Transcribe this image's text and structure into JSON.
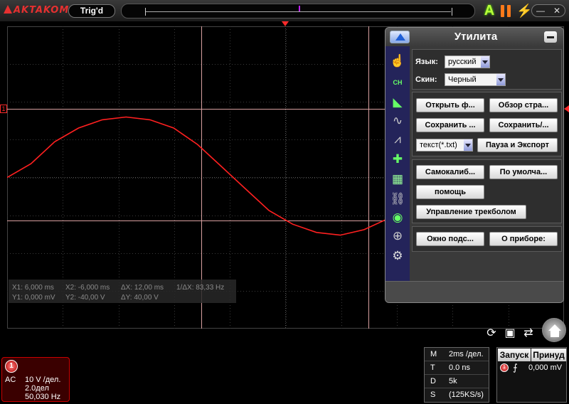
{
  "topbar": {
    "logo_text": "AKTAKOM",
    "trig_status": "Trig'd",
    "auto_icon": "A",
    "pause_icon": "pause-icon",
    "bolt_icon": "lightning-icon",
    "minimize_icon": "minimize-icon",
    "close_icon": "close-icon"
  },
  "cursors": {
    "x1": "X1: 6,000 ms",
    "x2": "X2: -6,000 ms",
    "dx": "ΔX: 12,00 ms",
    "inv_dx": "1/ΔX: 83,33 Hz",
    "y1": "Y1: 0,000 mV",
    "y2": "Y2: -40,00 V",
    "dy": "ΔY: 40,00 V"
  },
  "utility": {
    "title": "Утилита",
    "language_label": "Язык:",
    "language_value": "русский",
    "skin_label": "Скин:",
    "skin_value": "Черный",
    "open_file": "Открыть ф...",
    "browse": "Обзор стра...",
    "save1": "Сохранить ...",
    "save2": "Сохранить/...",
    "format_value": "текст(*.txt)",
    "pause_export": "Пауза и Экспорт",
    "selfcal": "Самокалиб...",
    "default": "По умолча...",
    "help": "помощь",
    "trackball": "Управление трекболом",
    "hint_window": "Окно подс...",
    "about": "О приборе:",
    "side_icons": [
      "hand-icon",
      "ch-icon",
      "ruler-icon",
      "wave-icon",
      "math-wave-icon",
      "cursor-icon",
      "calculator-icon",
      "link-icon",
      "toggle-icon",
      "zoom-icon",
      "gear-icon"
    ]
  },
  "channel1": {
    "label": "1",
    "coupling": "AC",
    "volts": "10 V /дел.",
    "offset": "2.0дел",
    "freq": "50,030 Hz"
  },
  "timebase": {
    "rows": [
      {
        "key": "M",
        "value": "2ms /дел."
      },
      {
        "key": "T",
        "value": "0.0 ns"
      },
      {
        "key": "D",
        "value": "5k"
      },
      {
        "key": "S",
        "value": "(125KS/s)"
      }
    ]
  },
  "trigger": {
    "run_label": "Запуск",
    "force_label": "Принуд",
    "channel": "1",
    "edge_icon": "rising-edge-icon",
    "level": "0,000 mV"
  },
  "chart_data": {
    "type": "line",
    "series": [
      {
        "x": [
          -10,
          -9,
          -8,
          -7,
          -6,
          -5,
          -4,
          -3,
          -2,
          -1,
          0,
          1,
          2,
          3,
          4,
          5,
          6,
          7,
          8,
          9,
          10,
          11,
          12,
          13
        ],
        "values": [
          0.0,
          0.5,
          1.3,
          1.8,
          2.1,
          2.2,
          2.1,
          1.8,
          1.2,
          0.4,
          -0.4,
          -1.2,
          -1.7,
          -2.0,
          -2.1,
          -1.9,
          -1.5,
          -0.8,
          0.0,
          0.7,
          1.3,
          1.6,
          1.8,
          1.7
        ]
      }
    ],
    "xlim": [
      -10,
      13.4
    ],
    "ylim": [
      -5.5,
      5.5
    ],
    "grid": true,
    "color": "#ff2020"
  }
}
